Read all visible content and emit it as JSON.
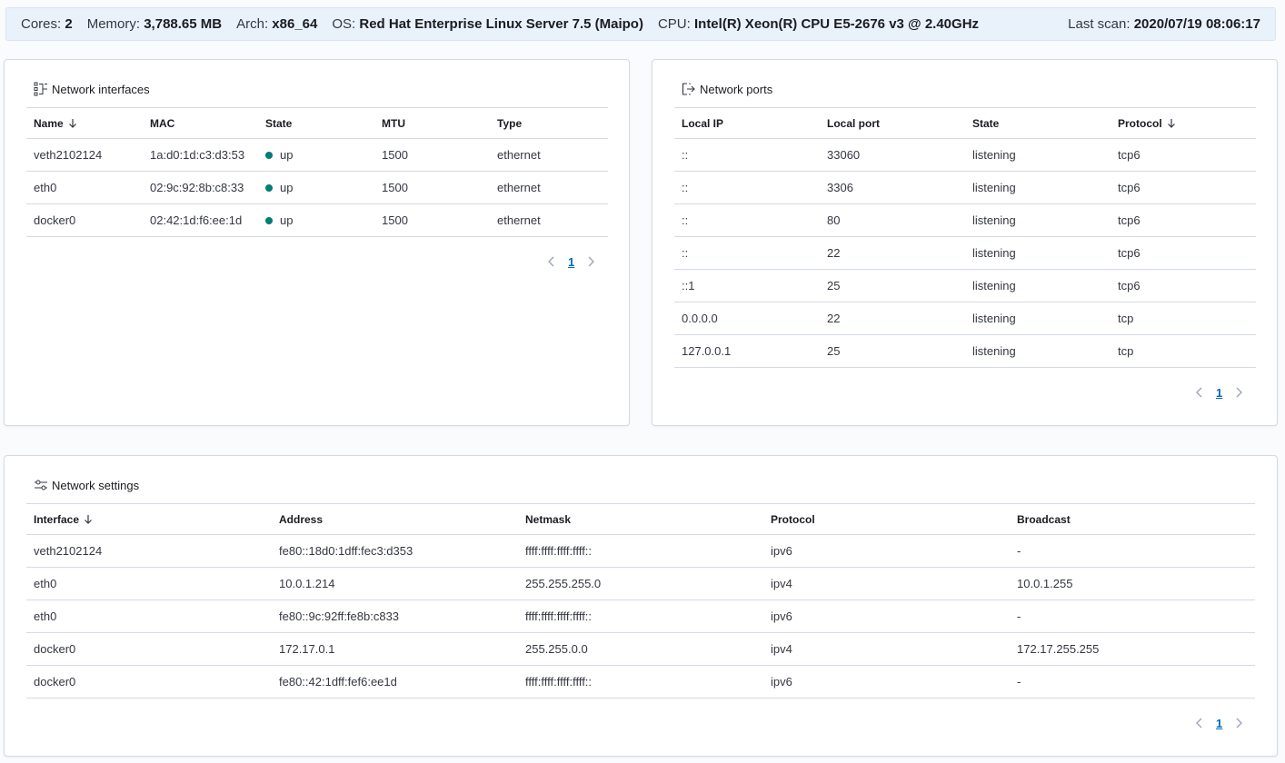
{
  "sysinfo": {
    "cores_label": "Cores:",
    "cores": "2",
    "memory_label": "Memory:",
    "memory": "3,788.65 MB",
    "arch_label": "Arch:",
    "arch": "x86_64",
    "os_label": "OS:",
    "os": "Red Hat Enterprise Linux Server 7.5 (Maipo)",
    "cpu_label": "CPU:",
    "cpu": "Intel(R) Xeon(R) CPU E5-2676 v3 @ 2.40GHz",
    "scan_label": "Last scan:",
    "scan": "2020/07/19 08:06:17"
  },
  "interfaces": {
    "title": "Network interfaces",
    "headers": [
      "Name",
      "MAC",
      "State",
      "MTU",
      "Type"
    ],
    "rows": [
      [
        "veth2102124",
        "1a:d0:1d:c3:d3:53",
        "up",
        "1500",
        "ethernet"
      ],
      [
        "eth0",
        "02:9c:92:8b:c8:33",
        "up",
        "1500",
        "ethernet"
      ],
      [
        "docker0",
        "02:42:1d:f6:ee:1d",
        "up",
        "1500",
        "ethernet"
      ]
    ],
    "page": "1"
  },
  "ports": {
    "title": "Network ports",
    "headers": [
      "Local IP",
      "Local port",
      "State",
      "Protocol"
    ],
    "rows": [
      [
        "::",
        "33060",
        "listening",
        "tcp6"
      ],
      [
        "::",
        "3306",
        "listening",
        "tcp6"
      ],
      [
        "::",
        "80",
        "listening",
        "tcp6"
      ],
      [
        "::",
        "22",
        "listening",
        "tcp6"
      ],
      [
        "::1",
        "25",
        "listening",
        "tcp6"
      ],
      [
        "0.0.0.0",
        "22",
        "listening",
        "tcp"
      ],
      [
        "127.0.0.1",
        "25",
        "listening",
        "tcp"
      ]
    ],
    "page": "1"
  },
  "settings": {
    "title": "Network settings",
    "headers": [
      "Interface",
      "Address",
      "Netmask",
      "Protocol",
      "Broadcast"
    ],
    "rows": [
      [
        "veth2102124",
        "fe80::18d0:1dff:fec3:d353",
        "ffff:ffff:ffff:ffff::",
        "ipv6",
        "-"
      ],
      [
        "eth0",
        "10.0.1.214",
        "255.255.255.0",
        "ipv4",
        "10.0.1.255"
      ],
      [
        "eth0",
        "fe80::9c:92ff:fe8b:c833",
        "ffff:ffff:ffff:ffff::",
        "ipv6",
        "-"
      ],
      [
        "docker0",
        "172.17.0.1",
        "255.255.0.0",
        "ipv4",
        "172.17.255.255"
      ],
      [
        "docker0",
        "fe80::42:1dff:fef6:ee1d",
        "ffff:ffff:ffff:ffff::",
        "ipv6",
        "-"
      ]
    ],
    "page": "1"
  },
  "colors": {
    "accent": "#006bb4",
    "status_up": "#017d73",
    "border": "#d3dae6"
  },
  "icons": {
    "interfaces": "network-interfaces-icon",
    "ports": "network-ports-icon",
    "settings": "network-settings-icon",
    "sort": "sort-down-arrow-icon"
  }
}
